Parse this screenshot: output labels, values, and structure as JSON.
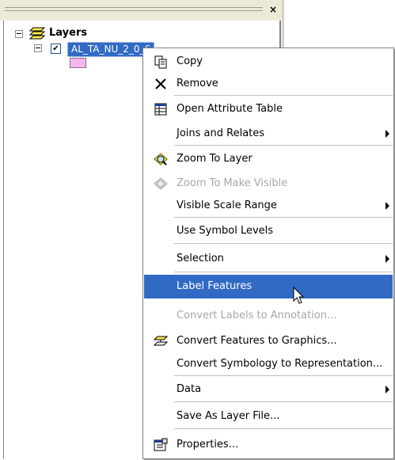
{
  "toc": {
    "close_glyph": "×",
    "root_label": "Layers",
    "layer_name": "AL_TA_NU_2_0_6",
    "layer_checked": "✔",
    "swatch_color": "#f3b6f0"
  },
  "menu": {
    "items": [
      {
        "label": "Copy",
        "icon": "copy-icon",
        "enabled": true
      },
      {
        "label": "Remove",
        "icon": "remove-x-icon",
        "enabled": true
      },
      {
        "label": "Open Attribute Table",
        "icon": "table-icon",
        "enabled": true
      },
      {
        "label": "Joins and Relates",
        "submenu": true,
        "enabled": true
      },
      {
        "label": "Zoom To Layer",
        "icon": "zoom-to-layer-icon",
        "enabled": true
      },
      {
        "label": "Zoom To Make Visible",
        "icon": "zoom-make-visible-icon",
        "enabled": false
      },
      {
        "label": "Visible Scale Range",
        "submenu": true,
        "enabled": true
      },
      {
        "label": "Use Symbol Levels",
        "enabled": true
      },
      {
        "label": "Selection",
        "submenu": true,
        "enabled": true
      },
      {
        "label": "Label Features",
        "highlighted": true,
        "enabled": true
      },
      {
        "label": "Convert Labels to Annotation...",
        "enabled": false
      },
      {
        "label": "Convert Features to Graphics...",
        "icon": "convert-graphics-icon",
        "enabled": true
      },
      {
        "label": "Convert Symbology to Representation...",
        "enabled": true
      },
      {
        "label": "Data",
        "submenu": true,
        "enabled": true
      },
      {
        "label": "Save As Layer File...",
        "enabled": true
      },
      {
        "label": "Properties...",
        "icon": "properties-icon",
        "enabled": true
      }
    ]
  },
  "colors": {
    "highlight": "#316ac5",
    "disabled_text": "#a7a6aa"
  }
}
